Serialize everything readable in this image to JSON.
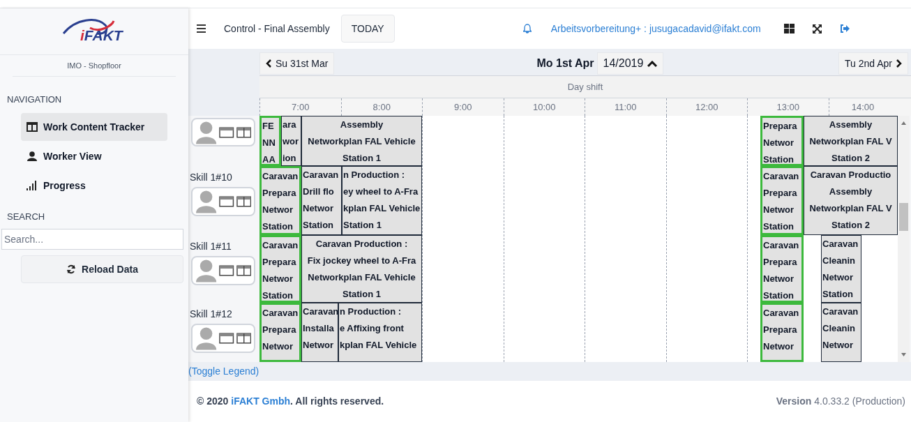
{
  "sidebar": {
    "logo_text": "iFAKT",
    "subtitle": "IMO - Shopfloor",
    "navigation_heading": "NAVIGATION",
    "nav_items": [
      {
        "label": "Work Content Tracker",
        "selected": true
      },
      {
        "label": "Worker View",
        "selected": false
      },
      {
        "label": "Progress",
        "selected": false
      }
    ],
    "search_heading": "SEARCH",
    "search": {
      "placeholder": "Search..."
    },
    "reload_button": "Reload Data"
  },
  "header": {
    "title": "Control - Final Assembly",
    "today_button": "TODAY",
    "user": "Arbeitsvorbereitung+ : jusugacadavid@ifakt.com"
  },
  "date_nav": {
    "previous": "Su 31st Mar",
    "current": "Mo 1st Apr",
    "week": "14/2019",
    "next": "Tu 2nd Apr"
  },
  "shift": "Day shift",
  "hours": [
    "7:00",
    "8:00",
    "9:00",
    "10:00",
    "11:00",
    "12:00",
    "13:00",
    "14:00"
  ],
  "lanes": [
    {
      "blocks": [
        {
          "lines": [
            "FE",
            "NN",
            "AA"
          ],
          "highlighted": true
        },
        {
          "lines": [
            "ara",
            "wor",
            "ion"
          ],
          "highlighted": false
        },
        {
          "lines": [
            "Assembly",
            "Networkplan FAL Vehicle",
            "Station 1"
          ],
          "highlighted": false
        },
        {
          "lines": [
            "Prepara",
            "Networ",
            "Station"
          ],
          "highlighted": true
        },
        {
          "lines": [
            "Assembly",
            "Networkplan FAL V",
            "Station 2"
          ],
          "highlighted": false
        }
      ]
    },
    {
      "label": "Skill 1#10",
      "blocks": [
        {
          "lines": [
            "Caravan",
            "Prepara",
            "Networ",
            "Station"
          ],
          "highlighted": true
        },
        {
          "lines": [
            "Caravan",
            "Drill flo",
            "Networ",
            "Station"
          ],
          "highlighted": false
        },
        {
          "lines": [
            "n Production :",
            "ey wheel to A-Fra",
            "kplan FAL Vehicle",
            "Station 1"
          ],
          "highlighted": false
        },
        {
          "lines": [
            "Caravan",
            "Prepara",
            "Networ",
            "Station"
          ],
          "highlighted": true
        },
        {
          "lines": [
            "Caravan Productio",
            "Assembly",
            "Networkplan FAL V",
            "Station 2"
          ],
          "highlighted": false
        }
      ]
    },
    {
      "label": "Skill 1#11",
      "blocks": [
        {
          "lines": [
            "Caravan",
            "Prepara",
            "Networ",
            "Station"
          ],
          "highlighted": true
        },
        {
          "lines": [
            "Caravan Production :",
            "Fix jockey wheel to A-Fra",
            "Networkplan FAL Vehicle",
            "Station 1"
          ],
          "highlighted": false
        },
        {
          "lines": [
            "Caravan",
            "Prepara",
            "Networ",
            "Station"
          ],
          "highlighted": true
        },
        {
          "lines": [
            "Caravan",
            "Cleanin",
            "Networ",
            "Station"
          ],
          "highlighted": false
        }
      ]
    },
    {
      "label": "Skill 1#12",
      "blocks": [
        {
          "lines": [
            "Caravan",
            "Prepara",
            "Networ"
          ],
          "highlighted": true
        },
        {
          "lines": [
            "Caravan",
            "Installa",
            "Networ"
          ],
          "highlighted": false
        },
        {
          "lines": [
            "n Production :",
            "e Affixing front",
            "kplan FAL Vehicle"
          ],
          "highlighted": false
        },
        {
          "lines": [
            "Caravan",
            "Prepara",
            "Networ"
          ],
          "highlighted": true
        },
        {
          "lines": [
            "Caravan",
            "Cleanin",
            "Networ"
          ],
          "highlighted": false
        }
      ]
    }
  ],
  "legend_toggle": "(Toggle Legend)",
  "footer": {
    "copyright_prefix": "© 2020",
    "company_link": "iFAKT Gmbh",
    "copyright_suffix": ". All rights reserved.",
    "version": "**Version** 4.0.33.2 (Production)"
  }
}
